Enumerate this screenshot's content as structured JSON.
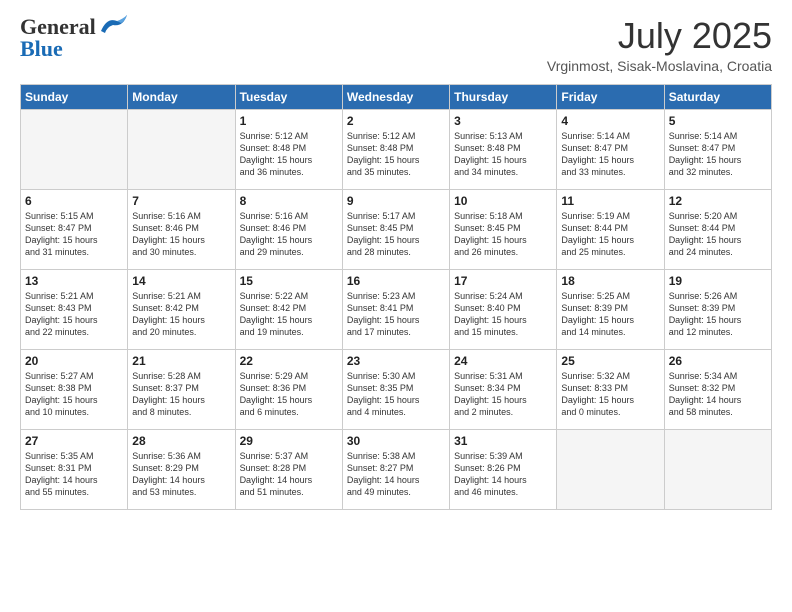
{
  "header": {
    "logo_general": "General",
    "logo_blue": "Blue",
    "month_year": "July 2025",
    "location": "Vrginmost, Sisak-Moslavina, Croatia"
  },
  "days_of_week": [
    "Sunday",
    "Monday",
    "Tuesday",
    "Wednesday",
    "Thursday",
    "Friday",
    "Saturday"
  ],
  "weeks": [
    [
      {
        "day": "",
        "content": ""
      },
      {
        "day": "",
        "content": ""
      },
      {
        "day": "1",
        "content": "Sunrise: 5:12 AM\nSunset: 8:48 PM\nDaylight: 15 hours\nand 36 minutes."
      },
      {
        "day": "2",
        "content": "Sunrise: 5:12 AM\nSunset: 8:48 PM\nDaylight: 15 hours\nand 35 minutes."
      },
      {
        "day": "3",
        "content": "Sunrise: 5:13 AM\nSunset: 8:48 PM\nDaylight: 15 hours\nand 34 minutes."
      },
      {
        "day": "4",
        "content": "Sunrise: 5:14 AM\nSunset: 8:47 PM\nDaylight: 15 hours\nand 33 minutes."
      },
      {
        "day": "5",
        "content": "Sunrise: 5:14 AM\nSunset: 8:47 PM\nDaylight: 15 hours\nand 32 minutes."
      }
    ],
    [
      {
        "day": "6",
        "content": "Sunrise: 5:15 AM\nSunset: 8:47 PM\nDaylight: 15 hours\nand 31 minutes."
      },
      {
        "day": "7",
        "content": "Sunrise: 5:16 AM\nSunset: 8:46 PM\nDaylight: 15 hours\nand 30 minutes."
      },
      {
        "day": "8",
        "content": "Sunrise: 5:16 AM\nSunset: 8:46 PM\nDaylight: 15 hours\nand 29 minutes."
      },
      {
        "day": "9",
        "content": "Sunrise: 5:17 AM\nSunset: 8:45 PM\nDaylight: 15 hours\nand 28 minutes."
      },
      {
        "day": "10",
        "content": "Sunrise: 5:18 AM\nSunset: 8:45 PM\nDaylight: 15 hours\nand 26 minutes."
      },
      {
        "day": "11",
        "content": "Sunrise: 5:19 AM\nSunset: 8:44 PM\nDaylight: 15 hours\nand 25 minutes."
      },
      {
        "day": "12",
        "content": "Sunrise: 5:20 AM\nSunset: 8:44 PM\nDaylight: 15 hours\nand 24 minutes."
      }
    ],
    [
      {
        "day": "13",
        "content": "Sunrise: 5:21 AM\nSunset: 8:43 PM\nDaylight: 15 hours\nand 22 minutes."
      },
      {
        "day": "14",
        "content": "Sunrise: 5:21 AM\nSunset: 8:42 PM\nDaylight: 15 hours\nand 20 minutes."
      },
      {
        "day": "15",
        "content": "Sunrise: 5:22 AM\nSunset: 8:42 PM\nDaylight: 15 hours\nand 19 minutes."
      },
      {
        "day": "16",
        "content": "Sunrise: 5:23 AM\nSunset: 8:41 PM\nDaylight: 15 hours\nand 17 minutes."
      },
      {
        "day": "17",
        "content": "Sunrise: 5:24 AM\nSunset: 8:40 PM\nDaylight: 15 hours\nand 15 minutes."
      },
      {
        "day": "18",
        "content": "Sunrise: 5:25 AM\nSunset: 8:39 PM\nDaylight: 15 hours\nand 14 minutes."
      },
      {
        "day": "19",
        "content": "Sunrise: 5:26 AM\nSunset: 8:39 PM\nDaylight: 15 hours\nand 12 minutes."
      }
    ],
    [
      {
        "day": "20",
        "content": "Sunrise: 5:27 AM\nSunset: 8:38 PM\nDaylight: 15 hours\nand 10 minutes."
      },
      {
        "day": "21",
        "content": "Sunrise: 5:28 AM\nSunset: 8:37 PM\nDaylight: 15 hours\nand 8 minutes."
      },
      {
        "day": "22",
        "content": "Sunrise: 5:29 AM\nSunset: 8:36 PM\nDaylight: 15 hours\nand 6 minutes."
      },
      {
        "day": "23",
        "content": "Sunrise: 5:30 AM\nSunset: 8:35 PM\nDaylight: 15 hours\nand 4 minutes."
      },
      {
        "day": "24",
        "content": "Sunrise: 5:31 AM\nSunset: 8:34 PM\nDaylight: 15 hours\nand 2 minutes."
      },
      {
        "day": "25",
        "content": "Sunrise: 5:32 AM\nSunset: 8:33 PM\nDaylight: 15 hours\nand 0 minutes."
      },
      {
        "day": "26",
        "content": "Sunrise: 5:34 AM\nSunset: 8:32 PM\nDaylight: 14 hours\nand 58 minutes."
      }
    ],
    [
      {
        "day": "27",
        "content": "Sunrise: 5:35 AM\nSunset: 8:31 PM\nDaylight: 14 hours\nand 55 minutes."
      },
      {
        "day": "28",
        "content": "Sunrise: 5:36 AM\nSunset: 8:29 PM\nDaylight: 14 hours\nand 53 minutes."
      },
      {
        "day": "29",
        "content": "Sunrise: 5:37 AM\nSunset: 8:28 PM\nDaylight: 14 hours\nand 51 minutes."
      },
      {
        "day": "30",
        "content": "Sunrise: 5:38 AM\nSunset: 8:27 PM\nDaylight: 14 hours\nand 49 minutes."
      },
      {
        "day": "31",
        "content": "Sunrise: 5:39 AM\nSunset: 8:26 PM\nDaylight: 14 hours\nand 46 minutes."
      },
      {
        "day": "",
        "content": ""
      },
      {
        "day": "",
        "content": ""
      }
    ]
  ]
}
